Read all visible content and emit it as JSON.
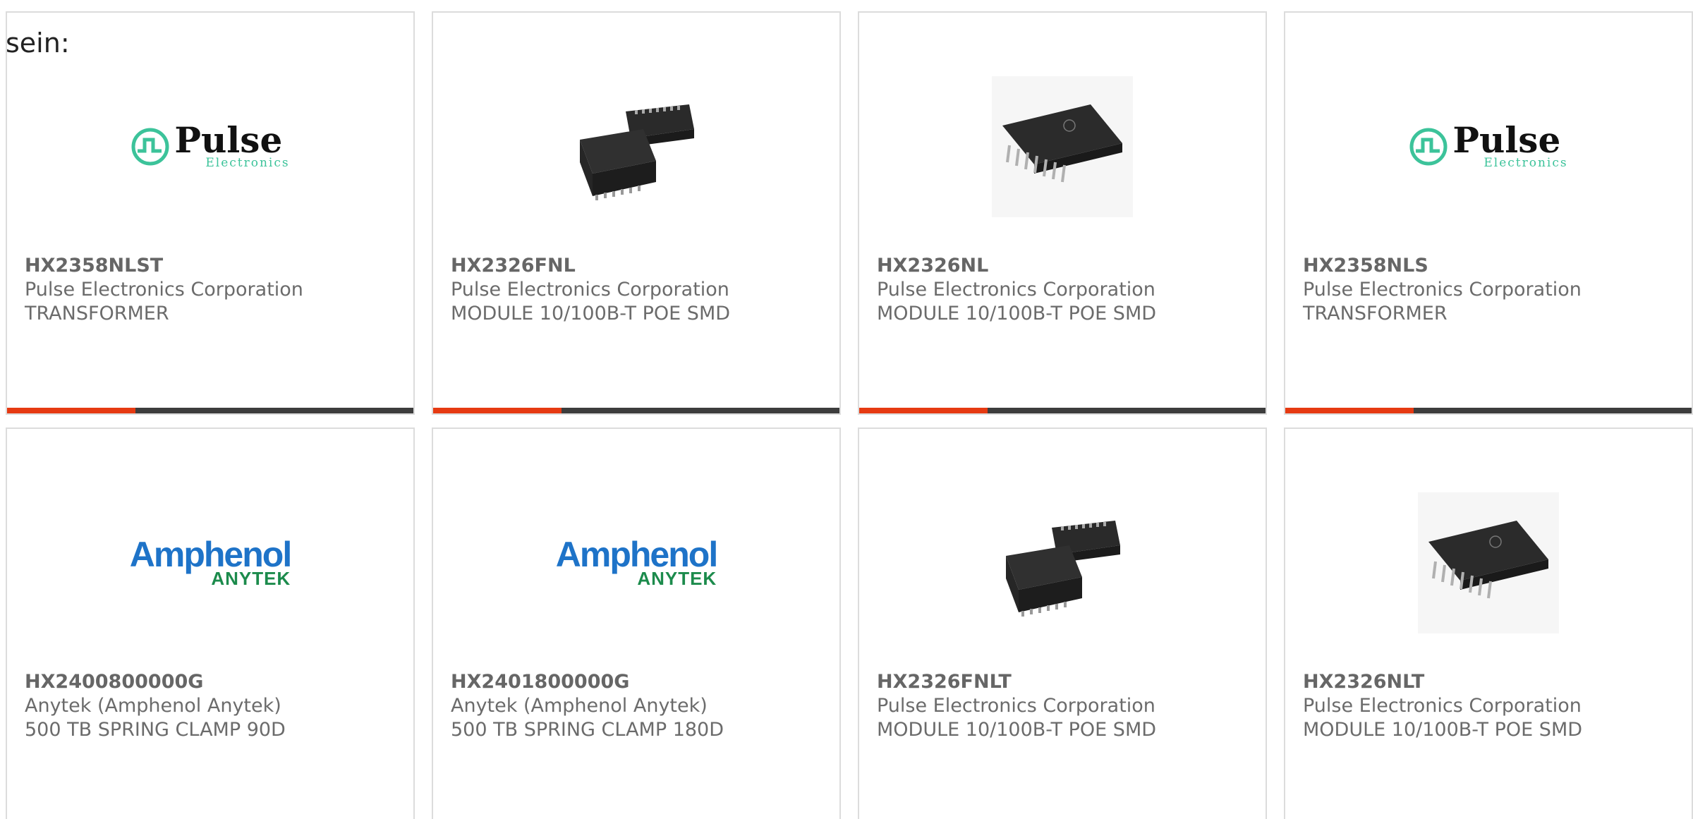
{
  "intro": {
    "text": "sein:"
  },
  "products": [
    {
      "part_number": "HX2358NLST",
      "manufacturer": "Pulse Electronics Corporation",
      "description": "TRANSFORMER",
      "image": "pulse-electronics-logo"
    },
    {
      "part_number": "HX2326FNL",
      "manufacturer": "Pulse Electronics Corporation",
      "description": "MODULE 10/100B-T POE SMD",
      "image": "smd-module-pair-photo"
    },
    {
      "part_number": "HX2326NL",
      "manufacturer": "Pulse Electronics Corporation",
      "description": "MODULE 10/100B-T POE SMD",
      "image": "smd-chip-photo"
    },
    {
      "part_number": "HX2358NLS",
      "manufacturer": "Pulse Electronics Corporation",
      "description": "TRANSFORMER",
      "image": "pulse-electronics-logo"
    },
    {
      "part_number": "HX2400800000G",
      "manufacturer": "Anytek (Amphenol Anytek)",
      "description": "500 TB SPRING CLAMP 90D",
      "image": "amphenol-anytek-logo"
    },
    {
      "part_number": "HX2401800000G",
      "manufacturer": "Anytek (Amphenol Anytek)",
      "description": "500 TB SPRING CLAMP 180D",
      "image": "amphenol-anytek-logo"
    },
    {
      "part_number": "HX2326FNLT",
      "manufacturer": "Pulse Electronics Corporation",
      "description": "MODULE 10/100B-T POE SMD",
      "image": "smd-module-pair-photo"
    },
    {
      "part_number": "HX2326NLT",
      "manufacturer": "Pulse Electronics Corporation",
      "description": "MODULE 10/100B-T POE SMD",
      "image": "smd-chip-photo"
    }
  ],
  "logos": {
    "pulse_word": "Pulse",
    "pulse_sub": "Electronics",
    "amphenol_word": "Amphenol",
    "amphenol_sub": "ANYTEK"
  },
  "colors": {
    "accent": "#e63a12",
    "bar": "#3d3d3d",
    "pulse_green": "#3cc39a",
    "amphenol_blue": "#1e73c8",
    "anytek_green": "#1c8b4c"
  }
}
